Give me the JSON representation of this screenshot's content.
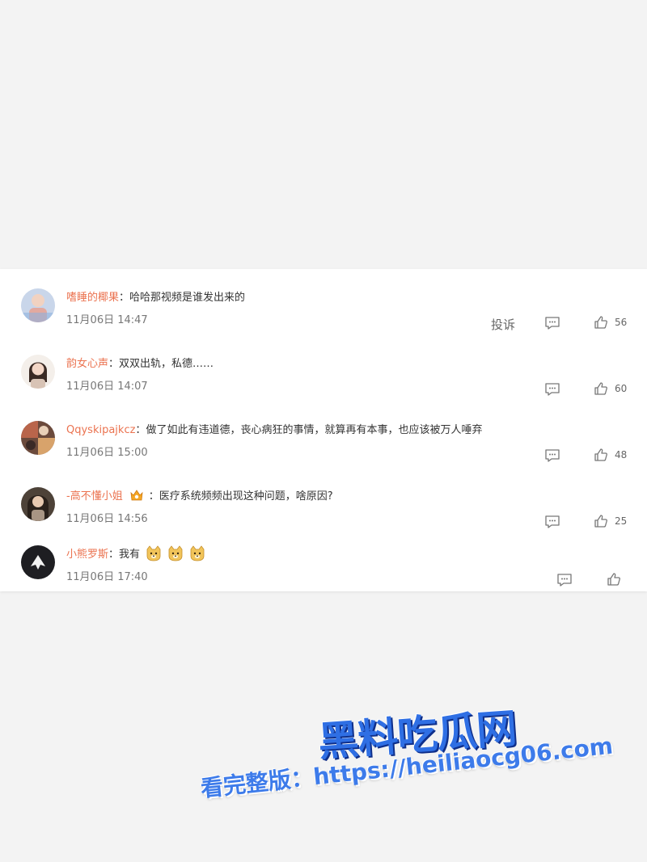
{
  "comments": [
    {
      "username": "嗜睡的椰果",
      "separator": "：",
      "text": "哈哈那视频是谁发出来的",
      "time": "11月06日 14:47",
      "report": "投诉",
      "likes": "56"
    },
    {
      "username": "韵女心声",
      "separator": "：",
      "text": "双双出轨，私德……",
      "time": "11月06日 14:07",
      "likes": "60"
    },
    {
      "username": "Qqyskipajkcz",
      "separator": "：",
      "text": "做了如此有违道德，丧心病狂的事情，就算再有本事，也应该被万人唾弃",
      "time": "11月06日 15:00",
      "likes": "48"
    },
    {
      "username": "-高不懂小姐",
      "separator": "：",
      "text": "医疗系统频频出现这种问题，啥原因?",
      "time": "11月06日 14:56",
      "likes": "25"
    },
    {
      "username": "小熊罗斯",
      "separator": "：",
      "text": "我有",
      "time": "11月06日 17:40",
      "likes": ""
    }
  ],
  "icons": {
    "reply": "comment-bubble-icon",
    "like": "thumbs-up-icon",
    "badge": "fan-badge-icon",
    "emoji": "doge-emoji-icon"
  },
  "colors": {
    "username": "#eb7350",
    "text": "#333333",
    "meta": "#777777",
    "watermark": "#2f6fe4"
  },
  "watermark": {
    "logo": "黑料吃瓜网",
    "url": "看完整版：https://heiliaocg06.com"
  }
}
